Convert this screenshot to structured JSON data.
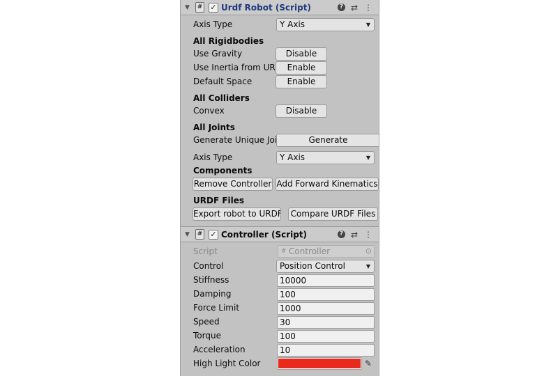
{
  "urdf_robot": {
    "title": "Urdf Robot (Script)",
    "axis_type_label": "Axis Type",
    "axis_type_value": "Y Axis",
    "rigidbodies": {
      "header": "All Rigidbodies",
      "rows": [
        {
          "label": "Use Gravity",
          "button": "Disable"
        },
        {
          "label": "Use Inertia from URD",
          "button": "Enable"
        },
        {
          "label": "Default Space",
          "button": "Enable"
        }
      ]
    },
    "colliders": {
      "header": "All Colliders",
      "rows": [
        {
          "label": "Convex",
          "button": "Disable"
        }
      ]
    },
    "joints": {
      "header": "All Joints",
      "generate_label": "Generate Unique Joi",
      "generate_button": "Generate",
      "axis_type_label": "Axis Type",
      "axis_type_value": "Y Axis"
    },
    "components": {
      "header": "Components",
      "remove_button": "Remove Controller",
      "add_button": "Add Forward Kinematics"
    },
    "urdf_files": {
      "header": "URDF Files",
      "export_button": "Export robot to URDF",
      "compare_button": "Compare URDF Files"
    }
  },
  "controller": {
    "title": "Controller (Script)",
    "script_label": "Script",
    "script_value": "Controller",
    "control_label": "Control",
    "control_value": "Position Control",
    "fields": [
      {
        "label": "Stiffness",
        "value": "10000"
      },
      {
        "label": "Damping",
        "value": "100"
      },
      {
        "label": "Force Limit",
        "value": "1000"
      },
      {
        "label": "Speed",
        "value": "30"
      },
      {
        "label": "Torque",
        "value": "100"
      },
      {
        "label": "Acceleration",
        "value": "10"
      }
    ],
    "highlight_label": "High Light Color",
    "highlight_color": "#e8291c"
  },
  "icons": {
    "foldout": "▼",
    "script": "#",
    "checkmark": "✓",
    "help": "?",
    "settings": "⇄",
    "menu": "⋮",
    "dropdown": "▼",
    "target": "⊙",
    "eyedropper": "✎"
  }
}
